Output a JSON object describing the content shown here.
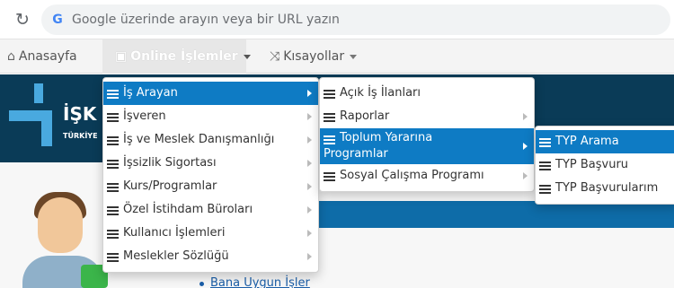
{
  "browser": {
    "omnibox_placeholder": "Google üzerinde arayın veya bir URL yazın"
  },
  "navbar": {
    "home_label": "Anasayfa",
    "online_label": "Online İşlemler",
    "shortcuts_label": "Kısayollar"
  },
  "site": {
    "logo_text": "İŞK",
    "logo_sub": "TÜRKİYE",
    "bottom_link": "Bana Uygun İşler"
  },
  "menu_main": {
    "items": [
      {
        "label": "İş Arayan",
        "active": true
      },
      {
        "label": "İşveren"
      },
      {
        "label": "İş ve Meslek Danışmanlığı"
      },
      {
        "label": "İşsizlik Sigortası"
      },
      {
        "label": "Kurs/Programlar"
      },
      {
        "label": "Özel İstihdam Büroları"
      },
      {
        "label": "Kullanıcı İşlemleri"
      },
      {
        "label": "Meslekler Sözlüğü"
      }
    ]
  },
  "menu_is_arayan": {
    "items": [
      {
        "label": "Açık İş İlanları"
      },
      {
        "label": "Raporlar"
      },
      {
        "label_line1": "Toplum Yararına",
        "label_line2": "Programlar",
        "active": true
      },
      {
        "label": "Sosyal Çalışma Programı"
      }
    ]
  },
  "menu_typ": {
    "items": [
      {
        "label": "TYP Arama",
        "active": true
      },
      {
        "label": "TYP Başvuru"
      },
      {
        "label": "TYP Başvurularım"
      }
    ]
  },
  "icons": {
    "reload": "reload-icon",
    "google": "google-icon",
    "home": "home-icon",
    "list": "list-icon",
    "shuffle": "shuffle-icon"
  }
}
